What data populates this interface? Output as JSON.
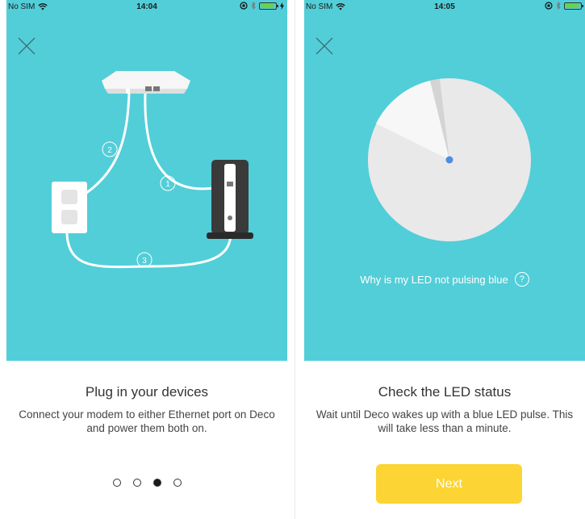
{
  "colors": {
    "teal_background": "#52ced8",
    "next_button": "#fcd433",
    "led_blue": "#4f8de0",
    "battery_green": "#6ad246"
  },
  "left_screen": {
    "status": {
      "carrier": "No SIM",
      "time": "14:04"
    },
    "illustration": {
      "labels": [
        "1",
        "2",
        "3"
      ],
      "items": [
        "deco-unit-icon",
        "power-outlet-icon",
        "modem-icon",
        "cable-1",
        "cable-2",
        "cable-3"
      ]
    },
    "title": "Plug in your devices",
    "description": "Connect your modem to either Ethernet port on Deco and power them both on.",
    "pager": {
      "total": 4,
      "current": 3
    }
  },
  "right_screen": {
    "status": {
      "carrier": "No SIM",
      "time": "14:05"
    },
    "led_help_text": "Why is my LED not pulsing blue",
    "help_icon_symbol": "?",
    "title": "Check the LED status",
    "description": "Wait until Deco wakes up with a blue LED pulse. This will take less than a minute.",
    "next_label": "Next"
  }
}
